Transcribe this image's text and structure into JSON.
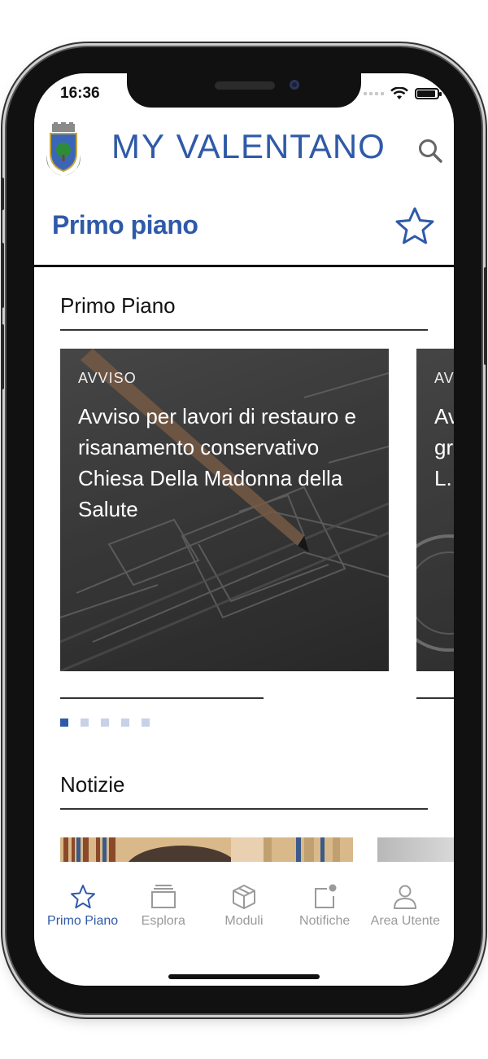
{
  "status_bar": {
    "time": "16:36"
  },
  "header": {
    "logo_prefix": "MY",
    "logo_name": "VALENTANO",
    "search_icon": "search-icon"
  },
  "page": {
    "title": "Primo piano",
    "favorite_icon": "star-outline-icon"
  },
  "sections": {
    "primo_piano": "Primo Piano",
    "notizie": "Notizie"
  },
  "cards": [
    {
      "category": "AVVISO",
      "title": "Avviso per lavori di restauro e risanamento conservativo Chiesa Della Madonna della Salute"
    },
    {
      "category": "AV",
      "title_lines": [
        "Av",
        "gr",
        "L."
      ]
    }
  ],
  "carousel": {
    "total": 5,
    "active_index": 0
  },
  "tabs": [
    {
      "label": "Primo Piano",
      "icon": "star-icon",
      "active": true
    },
    {
      "label": "Esplora",
      "icon": "cards-stack-icon",
      "active": false
    },
    {
      "label": "Moduli",
      "icon": "cube-icon",
      "active": false
    },
    {
      "label": "Notifiche",
      "icon": "notification-icon",
      "active": false
    },
    {
      "label": "Area Utente",
      "icon": "user-icon",
      "active": false
    }
  ],
  "colors": {
    "brand": "#2f5aa8",
    "inactive": "#9a9a9a",
    "dot_inactive": "#c8d2e6"
  }
}
